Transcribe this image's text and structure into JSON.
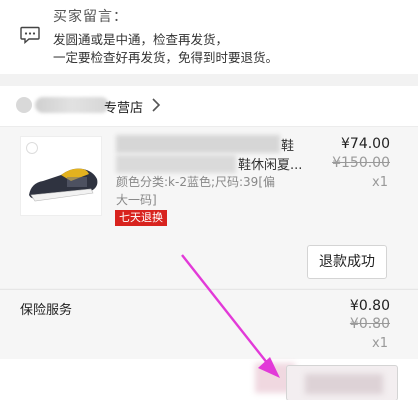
{
  "buyer_message": {
    "title": "买家留言：",
    "lines": [
      "发圆通或是中通，检查再发货，",
      "一定要检查好再发货，免得到时要退货。"
    ]
  },
  "shop": {
    "name_suffix": "专营店",
    "arrow_icon": "chevron-right-icon"
  },
  "item": {
    "title_fragment_1": "鞋",
    "title_fragment_2": "鞋休闲夏...",
    "sku_line_1": "颜色分类:k-2蓝色;尺码:39[偏",
    "sku_line_2": "大一码]",
    "tag": "七天退换",
    "price": "¥74.00",
    "original_price": "¥150.00",
    "quantity": "x1",
    "action_label": "退款成功"
  },
  "insurance": {
    "label": "保险服务",
    "price": "¥0.80",
    "original_price": "¥0.80",
    "quantity": "x1"
  },
  "colors": {
    "tag_background": "#d8231e",
    "annotation_arrow": "#e23ad8"
  }
}
